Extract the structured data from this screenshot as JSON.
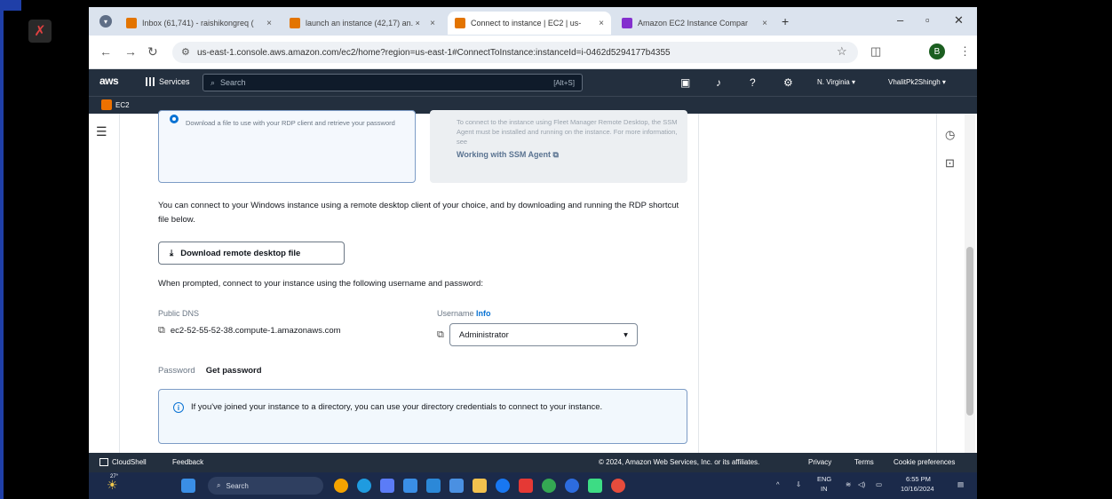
{
  "browser": {
    "tabs": [
      {
        "label": "Inbox (61,741) - raishikongreq (",
        "active": false,
        "color": "#e37400"
      },
      {
        "label": "launch an instance (42,17) an. ×",
        "active": false,
        "color": "#e37400"
      },
      {
        "label": "Connect to instance | EC2 | us-",
        "active": true,
        "color": "#e37400"
      },
      {
        "label": "Amazon EC2 Instance Compar",
        "active": false,
        "color": "#8430ce"
      }
    ],
    "new_tab": "+",
    "url": "us-east-1.console.aws.amazon.com/ec2/home?region=us-east-1#ConnectToInstance:instanceId=i-0462d5294177b4355"
  },
  "aws": {
    "logo": "aws",
    "services_label": "Services",
    "search_placeholder": "Search",
    "search_shortcut": "[Alt+S]",
    "region": "N. Virginia ▾",
    "account": "VhalitPk2Shingh ▾",
    "breadcrumb_service": "EC2"
  },
  "rdp": {
    "option_desc": "Download a file to use with your RDP client and retrieve your password",
    "option2_desc": "To connect to the instance using Fleet Manager Remote Desktop, the SSM Agent must be installed and running on the instance. For more information, see",
    "option2_link": "Working with SSM Agent",
    "intro": "You can connect to your Windows instance using a remote desktop client of your choice, and by downloading and running the RDP shortcut file below.",
    "download_button": "Download remote desktop file",
    "prompt": "When prompted, connect to your instance using the following username and password:",
    "dns_label": "Public DNS",
    "dns_value": "ec2-52-55-52-38.compute-1.amazonaws.com",
    "username_label": "Username",
    "username_info": "Info",
    "username_value": "Administrator",
    "password_label": "Password",
    "get_password": "Get password",
    "info_text": "If you've joined your instance to a directory, you can use your directory credentials to connect to your instance."
  },
  "footer": {
    "cloudshell": "CloudShell",
    "feedback": "Feedback",
    "copyright": "© 2024, Amazon Web Services, Inc. or its affiliates.",
    "privacy": "Privacy",
    "terms": "Terms",
    "cookies": "Cookie preferences"
  },
  "taskbar": {
    "temp": "27°",
    "search": "Search",
    "lang_top": "ENG",
    "lang_bottom": "IN",
    "time": "6:55 PM",
    "date": "10/16/2024"
  }
}
